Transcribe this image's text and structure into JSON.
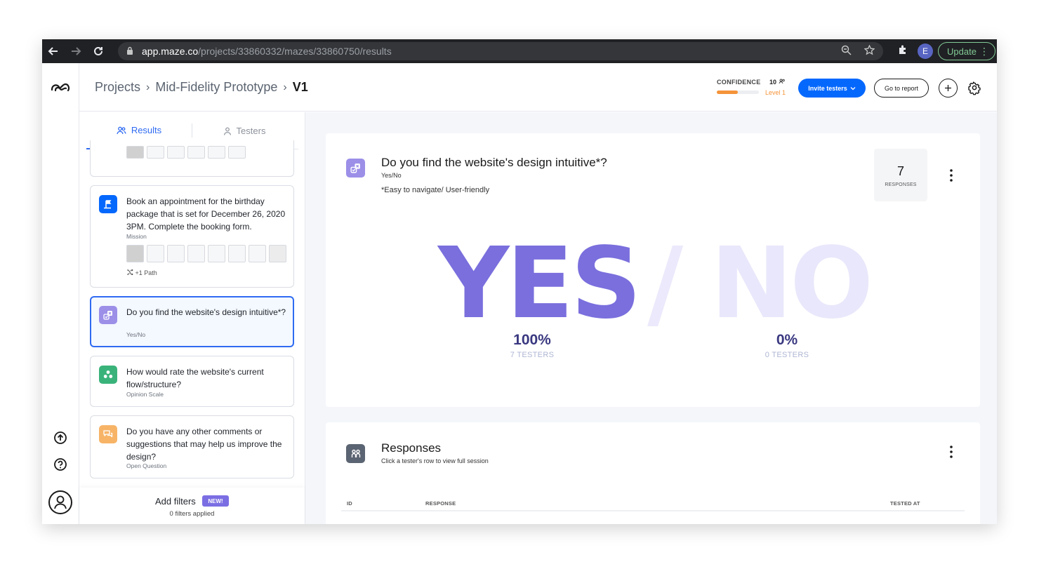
{
  "browser": {
    "url_host": "app.maze.co",
    "url_path": "/projects/33860332/mazes/33860750/results",
    "profile_initial": "E",
    "update_label": "Update"
  },
  "header": {
    "breadcrumbs": [
      "Projects",
      "Mid-Fidelity Prototype",
      "V1"
    ],
    "confidence_label": "CONFIDENCE",
    "confidence_count": "10",
    "confidence_level": "Level 1",
    "confidence_fill": 0.5,
    "invite_label": "Invite testers",
    "report_label": "Go to report"
  },
  "sidebar": {
    "tabs": [
      {
        "label": "Results",
        "active": true
      },
      {
        "label": "Testers",
        "active": false
      }
    ],
    "cards": [
      {
        "text": "Book an appointment for the birthday package that is set for December 26, 2020 3PM. Complete the booking form.",
        "type": "Mission",
        "paths": "+1 Path"
      },
      {
        "text": "Do you find the website's design intuitive*?",
        "type": "Yes/No"
      },
      {
        "text": "How would rate the website's current flow/structure?",
        "type": "Opinion Scale"
      },
      {
        "text": "Do you have any other comments or suggestions that may help us improve the design?",
        "type": "Open Question"
      }
    ],
    "filters": {
      "title": "Add filters",
      "badge": "NEW!",
      "subtitle": "0 filters applied"
    }
  },
  "main": {
    "question": {
      "title": "Do you find the website's design intuitive*?",
      "type": "Yes/No",
      "note": "*Easy to navigate/ User-friendly",
      "responses_count": "7",
      "responses_label": "RESPONSES"
    },
    "result": {
      "yes_word": "YES",
      "slash": "/",
      "no_word": "NO",
      "yes_pct": "100%",
      "no_pct": "0%",
      "yes_testers": "7 TESTERS",
      "no_testers": "0 TESTERS"
    },
    "responses": {
      "title": "Responses",
      "subtitle": "Click a tester's row to view full session",
      "columns": [
        "ID",
        "RESPONSE",
        "TESTED AT"
      ]
    }
  },
  "colors": {
    "accent": "#0568fd",
    "yes": "#7a6fdd",
    "no_faded": "#e9e7fb",
    "confidence": "#f5943a"
  }
}
